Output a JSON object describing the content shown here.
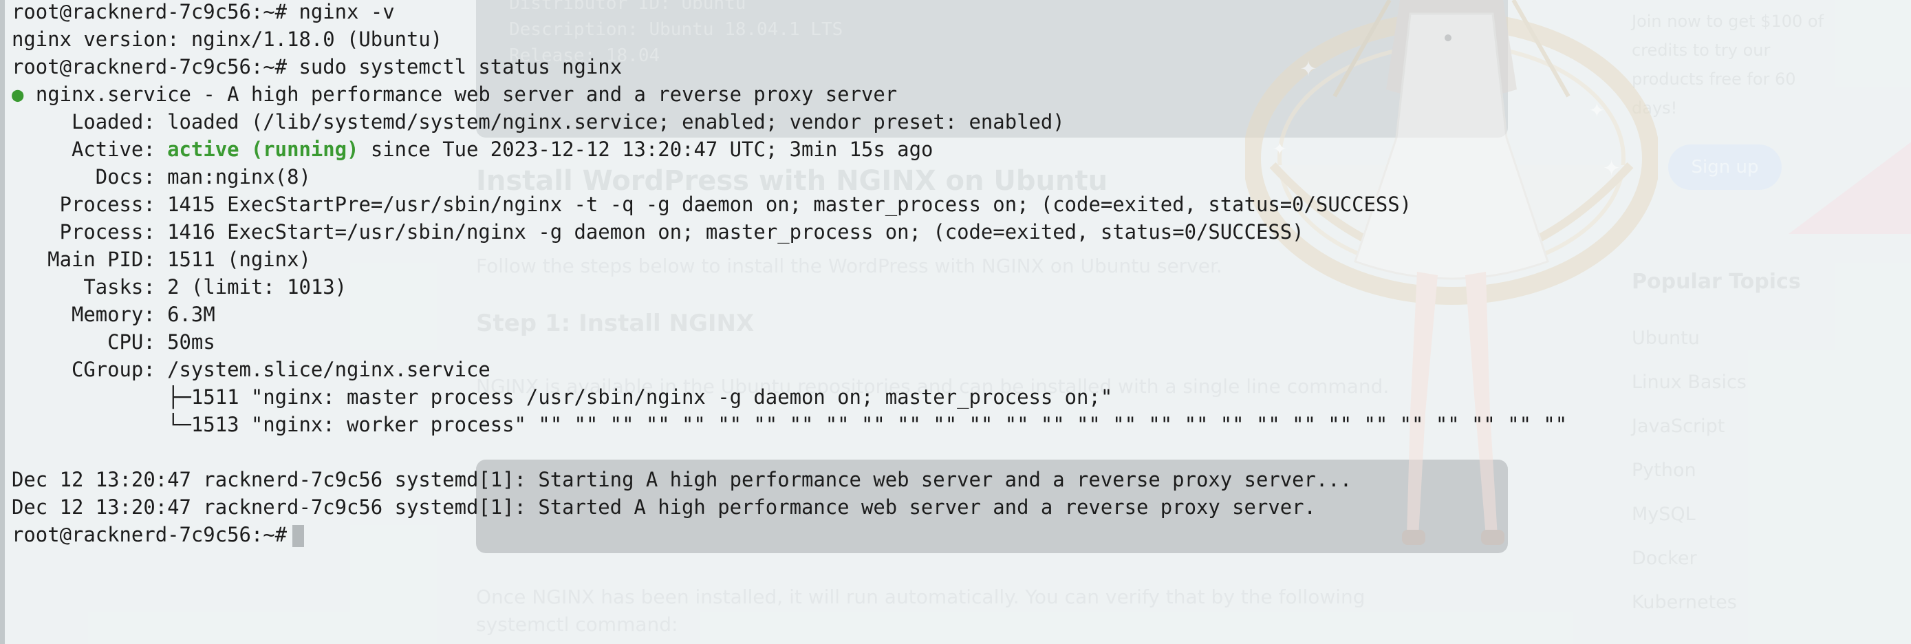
{
  "terminal": {
    "prompt": "root@racknerd-7c9c56:~#",
    "cmd1": "nginx -v",
    "version_output": "nginx version: nginx/1.18.0 (Ubuntu)",
    "cmd2": "sudo systemctl status nginx",
    "status_dot": "●",
    "service_line": "nginx.service - A high performance web server and a reverse proxy server",
    "loaded": {
      "label": "     Loaded:",
      "value": "loaded (/lib/systemd/system/nginx.service; enabled; vendor preset: enabled)"
    },
    "active": {
      "label": "     Active:",
      "state": "active (running)",
      "rest": "since Tue 2023-12-12 13:20:47 UTC; 3min 15s ago"
    },
    "docs": {
      "label": "       Docs:",
      "value": "man:nginx(8)"
    },
    "process1": {
      "label": "    Process:",
      "value": "1415 ExecStartPre=/usr/sbin/nginx -t -q -g daemon on; master_process on; (code=exited, status=0/SUCCESS)"
    },
    "process2": {
      "label": "    Process:",
      "value": "1416 ExecStart=/usr/sbin/nginx -g daemon on; master_process on; (code=exited, status=0/SUCCESS)"
    },
    "main_pid": {
      "label": "   Main PID:",
      "value": "1511 (nginx)"
    },
    "tasks": {
      "label": "      Tasks:",
      "value": "2 (limit: 1013)"
    },
    "memory": {
      "label": "     Memory:",
      "value": "6.3M"
    },
    "cpu": {
      "label": "        CPU:",
      "value": "50ms"
    },
    "cgroup": {
      "label": "     CGroup:",
      "value": "/system.slice/nginx.service"
    },
    "cgroup_tree": [
      "             ├─1511 \"nginx: master process /usr/sbin/nginx -g daemon on; master_process on;\"",
      "             └─1513 \"nginx: worker process\" \"\" \"\" \"\" \"\" \"\" \"\" \"\" \"\" \"\" \"\" \"\" \"\" \"\" \"\" \"\" \"\" \"\" \"\" \"\" \"\" \"\" \"\" \"\" \"\" \"\" \"\" \"\" \"\" \"\""
    ],
    "log_lines": [
      "Dec 12 13:20:47 racknerd-7c9c56 systemd[1]: Starting A high performance web server and a reverse proxy server...",
      "Dec 12 13:20:47 racknerd-7c9c56 systemd[1]: Started A high performance web server and a reverse proxy server."
    ],
    "colors": {
      "active_green": "#3a9a31",
      "text": "#1c1c1c"
    }
  },
  "background_page": {
    "code_line_1": "Distributor ID:  Ubuntu",
    "code_line_2": "Description:     Ubuntu 18.04.1 LTS",
    "code_line_3": "Release:         18.04",
    "heading": "Install WordPress with NGINX on Ubuntu",
    "intro": "Follow the steps below to install the WordPress with NGINX on Ubuntu server.",
    "step_heading": "Step 1: Install NGINX",
    "step_text": "NGINX is available in the Ubuntu repositories and can be installed with a single line command.",
    "after_text": "Once NGINX has been installed, it will run automatically. You can verify that by the following systemctl command:",
    "sidebar_text": "Join now to get $100 of credits to try our products free for 60 days!",
    "signup_label": "Sign up",
    "popular_topics_title": "Popular Topics",
    "topics": [
      "Ubuntu",
      "Linux Basics",
      "JavaScript",
      "Python",
      "MySQL",
      "Docker",
      "Kubernetes"
    ]
  }
}
